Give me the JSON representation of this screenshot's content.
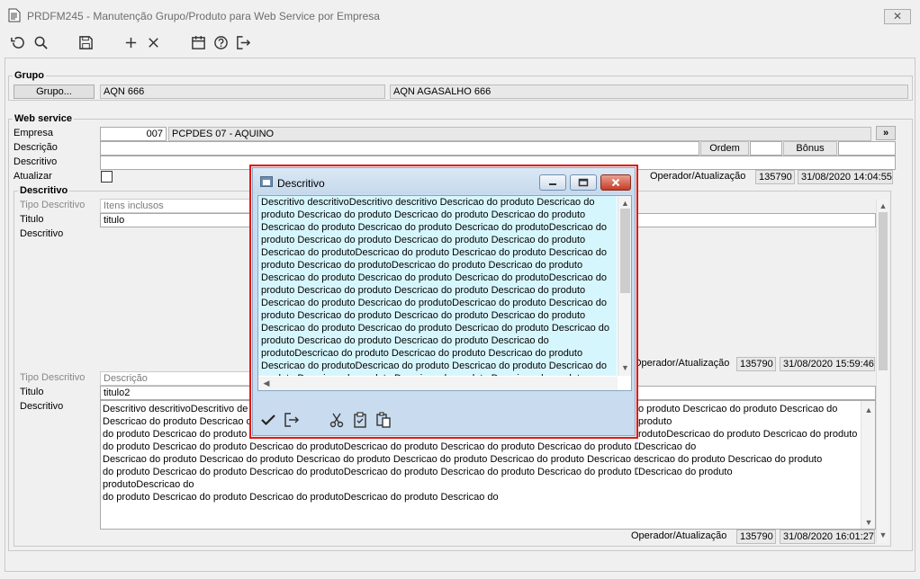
{
  "window": {
    "title": "PRDFM245 - Manutenção Grupo/Produto para Web Service por Empresa",
    "close_glyph": "✕"
  },
  "toolbar": {
    "icons": [
      "undo-icon",
      "search-icon",
      "save-icon",
      "add-icon",
      "delete-icon",
      "calendar-icon",
      "help-icon",
      "exit-icon"
    ]
  },
  "grupo": {
    "section_label": "Grupo",
    "button_label": "Grupo...",
    "code": "AQN 666",
    "name": "AQN AGASALHO 666"
  },
  "webservice": {
    "section_label": "Web service",
    "empresa_label": "Empresa",
    "empresa_code": "007",
    "empresa_name": "PCPDES 07 - AQUINO",
    "empresa_btn": "»",
    "descricao_label": "Descrição",
    "ordem_label": "Ordem",
    "bonus_label": "Bônus",
    "descritivo_label": "Descritivo",
    "atualizar_label": "Atualizar",
    "operador_label": "Operador/Atualização",
    "operador": "135790",
    "atualizacao": "31/08/2020 14:04:55"
  },
  "descritivo_section": {
    "section_label": "Descritivo",
    "item1": {
      "tipo_label": "Tipo Descritivo",
      "tipo_value": "Itens inclusos",
      "titulo_label": "Titulo",
      "titulo_value": "titulo",
      "descritivo_label": "Descritivo",
      "operador_label": "Operador/Atualização",
      "operador": "135790",
      "atualizacao": "31/08/2020 15:59:46"
    },
    "item2": {
      "tipo_label": "Tipo Descritivo",
      "tipo_value": "Descrição",
      "titulo_label": "Titulo",
      "titulo_value": "titulo2",
      "descritivo_label": "Descritivo",
      "descritivo_left": "Descritivo descritivoDescritivo de\nDescricao do produto Descricao d\ndo produto Descricao do produto D\ndo produto Descricao do produto Descricao do produtoDescricao do produto Descricao do produto Descricao do produto Descricao do produtoDescricao do produto\nDescricao do produto Descricao do produto Descricao do produto Descricao do produto Descricao do produto Descricao do produto Descricao do produto Descricao do\ndo produto Descricao do produto Descricao do produtoDescricao do produto Descricao do produto Descricao do produto Descricao do produto Descricao do produtoDescricao do\ndo produto Descricao do produto Descricao do produtoDescricao do produto Descricao do",
      "descritivo_right": "o produto Descricao do produto Descricao do produto\nrodutoDescricao do produto Descricao do produto Descricao do\nescricao do produto Descricao do produto Descricao do produto",
      "operador_label": "Operador/Atualização",
      "operador": "135790",
      "atualizacao": "31/08/2020 16:01:27"
    }
  },
  "dialog": {
    "title": "Descritivo",
    "text": "Descritivo descritivoDescritivo descritivo Descricao do produto Descricao do produto Descricao do produto Descricao do produto Descricao do produto Descricao do produto Descricao do produto Descricao do produtoDescricao do produto Descricao do produto Descricao do produto Descricao do produto Descricao do produtoDescricao do produto Descricao do produto Descricao do produto Descricao do produtoDescricao do produto Descricao do produto Descricao do produto Descricao do produto Descricao do produtoDescricao do produto Descricao do produto Descricao do produto Descricao do produto Descricao do produto Descricao do produtoDescricao do produto Descricao do produto Descricao do produto Descricao do produto Descricao do produto Descricao do produto Descricao do produto Descricao do produto Descricao do produto Descricao do produto Descricao do produto Descricao do produtoDescricao do produto Descricao do produto Descricao do produto Descricao do produtoDescricao do produto Descricao do produto Descricao do produto Descricao do produto Descricao do produto Descricao do produto Descricao do produto Descricao do produtoDescricao do produto Descricao",
    "tool_icons": [
      "confirm-icon",
      "exit-icon",
      "cut-icon",
      "paste-special-icon",
      "paste-icon"
    ]
  }
}
